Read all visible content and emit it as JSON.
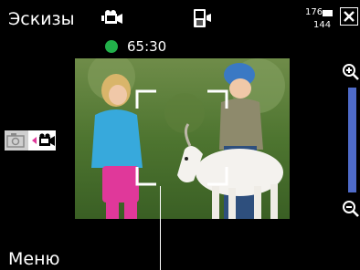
{
  "header": {
    "title": "Эскизы",
    "resolution_top": "176",
    "resolution_bottom": "144"
  },
  "recording": {
    "timer": "65:30",
    "status_color": "#22b04a"
  },
  "icons": {
    "video_mode": "video-camera-icon",
    "phone_camera": "phone-camera-icon",
    "close": "close-icon",
    "photo_mode": "photo-camera-icon",
    "zoom_in": "zoom-in-icon",
    "zoom_out": "zoom-out-icon"
  },
  "zoom": {
    "track_color": "#4f6bc9"
  },
  "softkeys": {
    "left": "Меню"
  }
}
